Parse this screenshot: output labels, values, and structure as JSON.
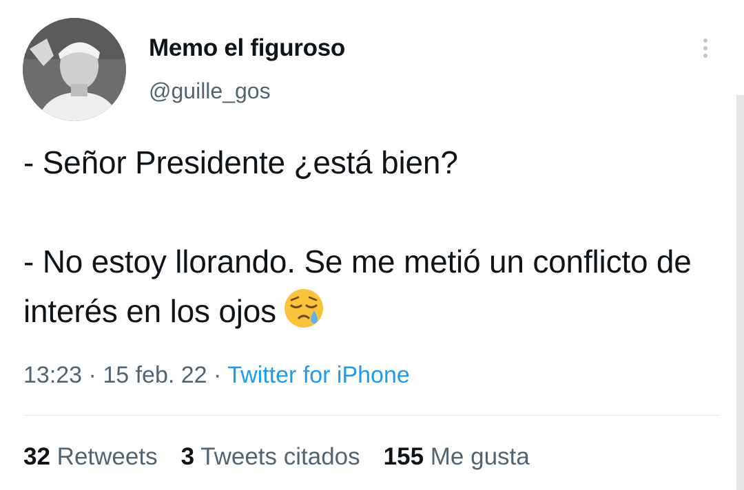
{
  "tweet": {
    "author": {
      "display_name": "Memo el figuroso",
      "handle": "@guille_gos"
    },
    "text": "- Señor Presidente ¿está bien?\n\n- No estoy llorando. Se me metió un conflicto de interés en los ojos",
    "emoji": "sleepy-face-icon",
    "time": "13:23",
    "date": "15 feb. 22",
    "separator": "·",
    "source": "Twitter for iPhone"
  },
  "stats": {
    "retweets_count": "32",
    "retweets_label": "Retweets",
    "quotes_count": "3",
    "quotes_label": "Tweets citados",
    "likes_count": "155",
    "likes_label": "Me gusta"
  },
  "colors": {
    "text": "#0f1419",
    "secondary": "#536471",
    "link": "#1d9bf0",
    "divider": "#e6ecf0"
  }
}
